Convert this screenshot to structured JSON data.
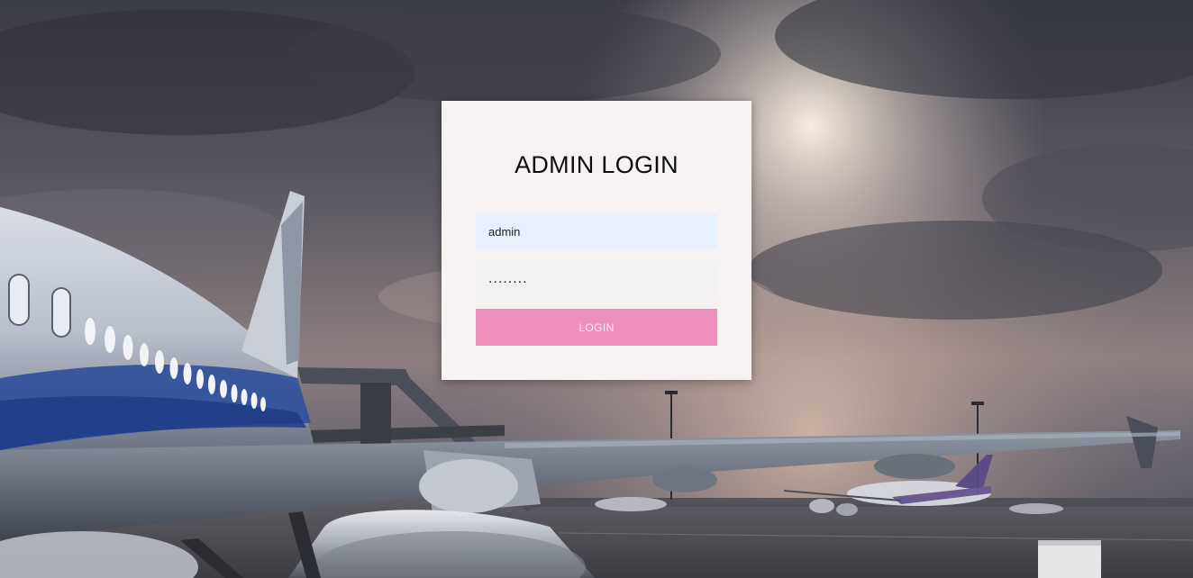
{
  "login": {
    "title": "ADMIN LOGIN",
    "username_value": "admin",
    "password_value": "........",
    "button_label": "LOGIN"
  },
  "colors": {
    "card_background": "#f6f2f2",
    "username_field_background": "#e8f0fe",
    "password_field_background": "#f1f1f1",
    "button_background": "#ef8fbd",
    "button_text": "#fbe9f2",
    "title_text": "#0d0d0d"
  },
  "background": {
    "scene": "airport-apron-airplane-at-dusk"
  }
}
